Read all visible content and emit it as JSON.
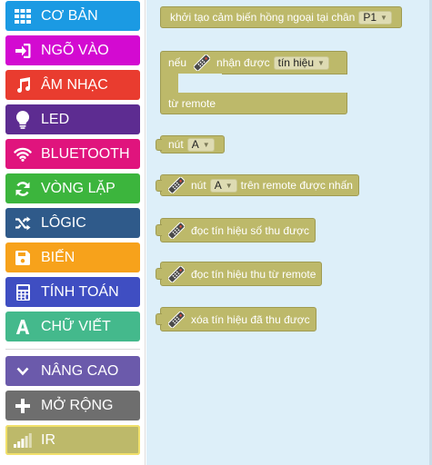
{
  "sidebar": {
    "categories": [
      {
        "label": "CƠ BẢN",
        "color": "#1b9ae3",
        "icon": "grid-icon"
      },
      {
        "label": "NGÕ VÀO",
        "color": "#d30ad1",
        "icon": "sign-in-icon"
      },
      {
        "label": "ÂM NHẠC",
        "color": "#e93c2f",
        "icon": "music-note-icon"
      },
      {
        "label": "LED",
        "color": "#5d2c91",
        "icon": "lightbulb-icon"
      },
      {
        "label": "BLUETOOTH",
        "color": "#e0147d",
        "icon": "wifi-icon"
      },
      {
        "label": "VÒNG LẶP",
        "color": "#3cb53d",
        "icon": "refresh-icon"
      },
      {
        "label": "LÔGIC",
        "color": "#2f5a8a",
        "icon": "shuffle-icon"
      },
      {
        "label": "BIẾN",
        "color": "#f7a21b",
        "icon": "floppy-disk-icon"
      },
      {
        "label": "TÍNH TOÁN",
        "color": "#3f4ec2",
        "icon": "calculator-icon"
      },
      {
        "label": "CHỮ VIẾT",
        "color": "#44b98c",
        "icon": "letter-a-icon"
      },
      {
        "label": "NÂNG CAO",
        "color": "#6b5aab",
        "icon": "chevron-down-icon"
      },
      {
        "label": "MỞ RỘNG",
        "color": "#6e6e6e",
        "icon": "plus-icon"
      },
      {
        "label": "IR",
        "color": "#bdb96a",
        "icon": "signal-bars-icon"
      }
    ]
  },
  "flyout": {
    "block_color": "#bdb96a",
    "init_block": {
      "text": "khởi tạo cảm biến hồng ngoại tại chân",
      "dropdown": "P1"
    },
    "if_block": {
      "if_label": "nếu",
      "mid_label": "nhận được",
      "dropdown": "tín hiệu",
      "bottom_label": "từ remote"
    },
    "button_block": {
      "label": "nút",
      "dropdown": "A"
    },
    "pressed_block": {
      "label": "nút",
      "dropdown": "A",
      "suffix": "trên remote được nhấn"
    },
    "read_digital_block": {
      "text": "đọc tín hiệu số thu được"
    },
    "read_remote_block": {
      "text": "đọc tín hiệu thu từ remote"
    },
    "clear_block": {
      "text": "xóa tín hiệu đã thu được"
    },
    "icon_name": "remote-control-icon"
  }
}
